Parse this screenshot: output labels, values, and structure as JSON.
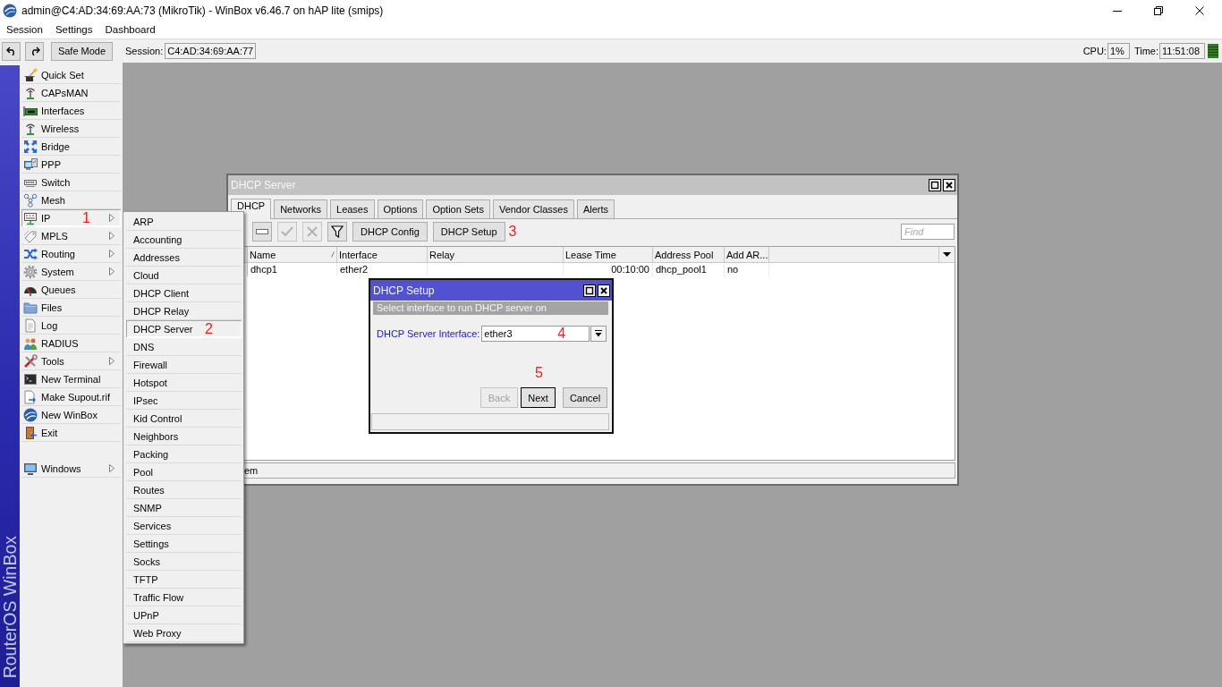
{
  "window": {
    "title": "admin@C4:AD:34:69:AA:73 (MikroTik) - WinBox v6.46.7 on hAP lite (smips)"
  },
  "menu_bar": [
    "Session",
    "Settings",
    "Dashboard"
  ],
  "toolbar": {
    "safe_mode": "Safe Mode",
    "session_label": "Session:",
    "session_value": "C4:AD:34:69:AA:77",
    "cpu_label": "CPU:",
    "cpu_value": "1%",
    "time_label": "Time:",
    "time_value": "11:51:08"
  },
  "sidebar": {
    "brand": "RouterOS WinBox",
    "items": [
      {
        "label": "Quick Set",
        "has_submenu": false,
        "selected": false
      },
      {
        "label": "CAPsMAN",
        "has_submenu": false,
        "selected": false
      },
      {
        "label": "Interfaces",
        "has_submenu": false,
        "selected": false
      },
      {
        "label": "Wireless",
        "has_submenu": false,
        "selected": false
      },
      {
        "label": "Bridge",
        "has_submenu": false,
        "selected": false
      },
      {
        "label": "PPP",
        "has_submenu": false,
        "selected": false
      },
      {
        "label": "Switch",
        "has_submenu": false,
        "selected": false
      },
      {
        "label": "Mesh",
        "has_submenu": false,
        "selected": false
      },
      {
        "label": "IP",
        "has_submenu": true,
        "selected": true,
        "note": "1"
      },
      {
        "label": "MPLS",
        "has_submenu": true,
        "selected": false
      },
      {
        "label": "Routing",
        "has_submenu": true,
        "selected": false
      },
      {
        "label": "System",
        "has_submenu": true,
        "selected": false
      },
      {
        "label": "Queues",
        "has_submenu": false,
        "selected": false
      },
      {
        "label": "Files",
        "has_submenu": false,
        "selected": false
      },
      {
        "label": "Log",
        "has_submenu": false,
        "selected": false
      },
      {
        "label": "RADIUS",
        "has_submenu": false,
        "selected": false
      },
      {
        "label": "Tools",
        "has_submenu": true,
        "selected": false
      },
      {
        "label": "New Terminal",
        "has_submenu": false,
        "selected": false
      },
      {
        "label": "Make Supout.rif",
        "has_submenu": false,
        "selected": false
      },
      {
        "label": "New WinBox",
        "has_submenu": false,
        "selected": false
      },
      {
        "label": "Exit",
        "has_submenu": false,
        "selected": false
      }
    ],
    "footer_items": [
      {
        "label": "Windows",
        "has_submenu": true,
        "selected": false
      }
    ]
  },
  "ip_submenu": {
    "items": [
      {
        "label": "ARP",
        "selected": false
      },
      {
        "label": "Accounting",
        "selected": false
      },
      {
        "label": "Addresses",
        "selected": false
      },
      {
        "label": "Cloud",
        "selected": false
      },
      {
        "label": "DHCP Client",
        "selected": false
      },
      {
        "label": "DHCP Relay",
        "selected": false
      },
      {
        "label": "DHCP Server",
        "selected": true,
        "note": "2"
      },
      {
        "label": "DNS",
        "selected": false
      },
      {
        "label": "Firewall",
        "selected": false
      },
      {
        "label": "Hotspot",
        "selected": false
      },
      {
        "label": "IPsec",
        "selected": false
      },
      {
        "label": "Kid Control",
        "selected": false
      },
      {
        "label": "Neighbors",
        "selected": false
      },
      {
        "label": "Packing",
        "selected": false
      },
      {
        "label": "Pool",
        "selected": false
      },
      {
        "label": "Routes",
        "selected": false
      },
      {
        "label": "SNMP",
        "selected": false
      },
      {
        "label": "Services",
        "selected": false
      },
      {
        "label": "Settings",
        "selected": false
      },
      {
        "label": "Socks",
        "selected": false
      },
      {
        "label": "TFTP",
        "selected": false
      },
      {
        "label": "Traffic Flow",
        "selected": false
      },
      {
        "label": "UPnP",
        "selected": false
      },
      {
        "label": "Web Proxy",
        "selected": false
      }
    ]
  },
  "dhcp_server_window": {
    "title": "DHCP Server",
    "active": false,
    "tabs": [
      {
        "label": "DHCP",
        "selected": true
      },
      {
        "label": "Networks",
        "selected": false
      },
      {
        "label": "Leases",
        "selected": false
      },
      {
        "label": "Options",
        "selected": false
      },
      {
        "label": "Option Sets",
        "selected": false
      },
      {
        "label": "Vendor Classes",
        "selected": false
      },
      {
        "label": "Alerts",
        "selected": false
      }
    ],
    "icon_buttons": [
      {
        "disabled": false
      },
      {
        "disabled": true
      },
      {
        "disabled": true
      },
      {
        "disabled": false
      }
    ],
    "text_buttons": [
      {
        "label": "DHCP Config"
      },
      {
        "label": "DHCP Setup",
        "note": "3"
      }
    ],
    "find": {
      "placeholder": "Find"
    },
    "table": {
      "columns": [
        {
          "label": "Name",
          "sorted": true
        },
        {
          "label": "Interface",
          "sorted": false
        },
        {
          "label": "Relay",
          "sorted": false
        },
        {
          "label": "Lease Time",
          "sorted": false
        },
        {
          "label": "Address Pool",
          "sorted": false
        },
        {
          "label": "Add AR...",
          "sorted": false
        }
      ],
      "rows": [
        {
          "cells": [
            "dhcp1",
            "ether2",
            null,
            "00:10:00",
            "dhcp_pool1",
            "no"
          ]
        }
      ]
    },
    "status_bar": "em"
  },
  "dhcp_setup_dialog": {
    "title": "DHCP Setup",
    "active": true,
    "instruction": "Select interface to run DHCP server on",
    "field_label": "DHCP Server Interface:",
    "field_value": "ether3",
    "field_note": "4",
    "note": "5",
    "buttons": [
      {
        "label": "Back",
        "disabled": true,
        "focused": false
      },
      {
        "label": "Next",
        "disabled": false,
        "focused": true
      },
      {
        "label": "Cancel",
        "disabled": false,
        "focused": false
      }
    ]
  }
}
